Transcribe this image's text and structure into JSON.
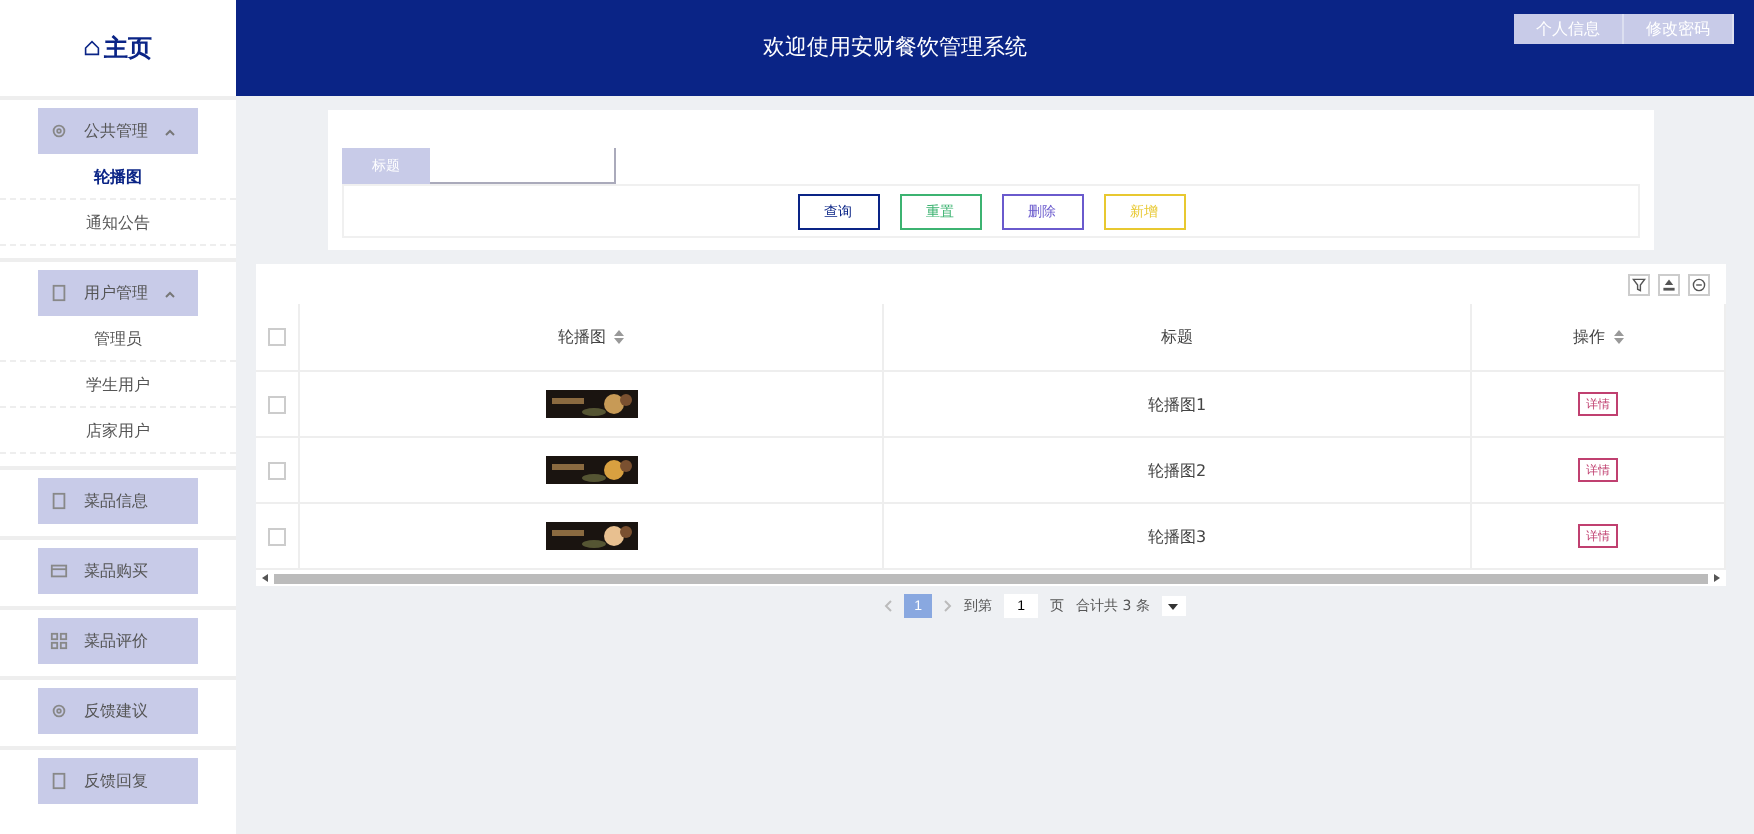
{
  "brand": {
    "label": "主页"
  },
  "header": {
    "title": "欢迎使用安财餐饮管理系统",
    "buttons": [
      "个人信息",
      "修改密码"
    ]
  },
  "sidebar": {
    "items": [
      {
        "label": "公共管理",
        "expanded": true,
        "children": [
          {
            "label": "轮播图",
            "selected": true
          },
          {
            "label": "通知公告",
            "selected": false
          }
        ]
      },
      {
        "label": "用户管理",
        "expanded": true,
        "children": [
          {
            "label": "管理员",
            "selected": false
          },
          {
            "label": "学生用户",
            "selected": false
          },
          {
            "label": "店家用户",
            "selected": false
          }
        ]
      },
      {
        "label": "菜品信息",
        "expanded": false
      },
      {
        "label": "菜品购买",
        "expanded": false
      },
      {
        "label": "菜品评价",
        "expanded": false
      },
      {
        "label": "反馈建议",
        "expanded": false
      },
      {
        "label": "反馈回复",
        "expanded": false
      }
    ]
  },
  "search": {
    "label": "标题",
    "buttons": [
      {
        "label": "查询",
        "kind": "query"
      },
      {
        "label": "重置",
        "kind": "reset"
      },
      {
        "label": "删除",
        "kind": "delete"
      },
      {
        "label": "新增",
        "kind": "add"
      }
    ]
  },
  "table": {
    "select_all": {
      "checked": false
    },
    "columns": [
      {
        "label": "轮播图",
        "sortable": true
      },
      {
        "label": "标题",
        "sortable": false
      },
      {
        "label": "操作",
        "sortable": true
      }
    ],
    "rows": [
      {
        "checked": false,
        "title": "轮播图1",
        "action": "详情"
      },
      {
        "checked": false,
        "title": "轮播图2",
        "action": "详情"
      },
      {
        "checked": false,
        "title": "轮播图3",
        "action": "详情"
      }
    ]
  },
  "pagination": {
    "pages": [
      {
        "label": "1",
        "selected": true
      }
    ],
    "goto_label": "到第",
    "goto_value": "1",
    "page_suffix": "页",
    "total": "合计共 3 条"
  }
}
